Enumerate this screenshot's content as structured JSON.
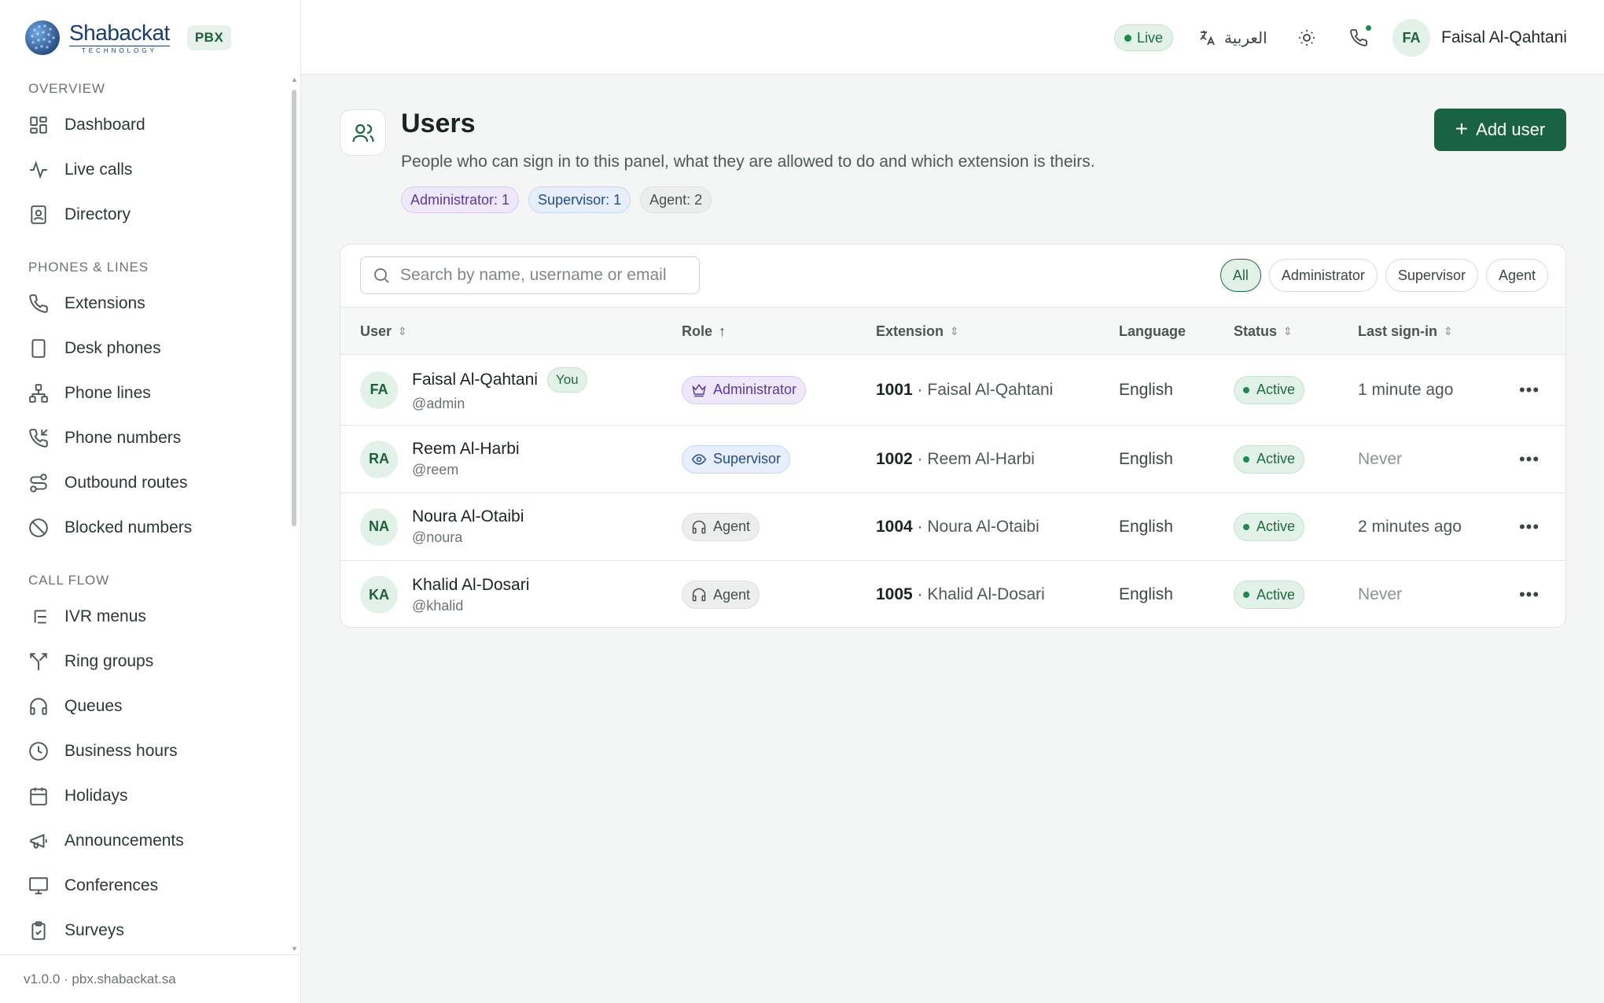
{
  "brand": {
    "name": "Shabackat",
    "sub": "TECHNOLOGY",
    "badge": "PBX"
  },
  "sidebar": {
    "sections": [
      {
        "title": "OVERVIEW",
        "items": [
          {
            "label": "Dashboard",
            "icon": "dashboard-icon"
          },
          {
            "label": "Live calls",
            "icon": "activity-icon"
          },
          {
            "label": "Directory",
            "icon": "contact-book-icon"
          }
        ]
      },
      {
        "title": "PHONES & LINES",
        "items": [
          {
            "label": "Extensions",
            "icon": "phone-icon"
          },
          {
            "label": "Desk phones",
            "icon": "device-icon"
          },
          {
            "label": "Phone lines",
            "icon": "network-icon"
          },
          {
            "label": "Phone numbers",
            "icon": "phone-incoming-icon"
          },
          {
            "label": "Outbound routes",
            "icon": "route-icon"
          },
          {
            "label": "Blocked numbers",
            "icon": "ban-icon"
          }
        ]
      },
      {
        "title": "CALL FLOW",
        "items": [
          {
            "label": "IVR menus",
            "icon": "list-tree-icon"
          },
          {
            "label": "Ring groups",
            "icon": "split-icon"
          },
          {
            "label": "Queues",
            "icon": "headset-icon"
          },
          {
            "label": "Business hours",
            "icon": "clock-icon"
          },
          {
            "label": "Holidays",
            "icon": "calendar-icon"
          },
          {
            "label": "Announcements",
            "icon": "megaphone-icon"
          },
          {
            "label": "Conferences",
            "icon": "presentation-icon"
          },
          {
            "label": "Surveys",
            "icon": "clipboard-icon"
          }
        ]
      }
    ],
    "footer": "v1.0.0 · pbx.shabackat.sa"
  },
  "topbar": {
    "live": "Live",
    "language": "العربية",
    "user_initials": "FA",
    "user_name": "Faisal Al-Qahtani"
  },
  "page": {
    "title": "Users",
    "description": "People who can sign in to this panel, what they are allowed to do and which extension is theirs.",
    "counts": {
      "admin": "Administrator: 1",
      "supervisor": "Supervisor: 1",
      "agent": "Agent: 2"
    },
    "add_button": "Add user"
  },
  "search": {
    "placeholder": "Search by name, username or email",
    "value": ""
  },
  "filters": [
    "All",
    "Administrator",
    "Supervisor",
    "Agent"
  ],
  "active_filter": "All",
  "table": {
    "columns": {
      "user": "User",
      "role": "Role",
      "extension": "Extension",
      "language": "Language",
      "status": "Status",
      "last_signin": "Last sign-in"
    },
    "rows": [
      {
        "initials": "FA",
        "name": "Faisal Al-Qahtani",
        "you": "You",
        "handle": "@admin",
        "role": "Administrator",
        "ext": "1001",
        "ext_name": " · Faisal Al-Qahtani",
        "language": "English",
        "status": "Active",
        "last_signin": "1 minute ago"
      },
      {
        "initials": "RA",
        "name": "Reem Al-Harbi",
        "handle": "@reem",
        "role": "Supervisor",
        "ext": "1002",
        "ext_name": " · Reem Al-Harbi",
        "language": "English",
        "status": "Active",
        "last_signin": "Never"
      },
      {
        "initials": "NA",
        "name": "Noura Al-Otaibi",
        "handle": "@noura",
        "role": "Agent",
        "ext": "1004",
        "ext_name": " · Noura Al-Otaibi",
        "language": "English",
        "status": "Active",
        "last_signin": "2 minutes ago"
      },
      {
        "initials": "KA",
        "name": "Khalid Al-Dosari",
        "handle": "@khalid",
        "role": "Agent",
        "ext": "1005",
        "ext_name": " · Khalid Al-Dosari",
        "language": "English",
        "status": "Active",
        "last_signin": "Never"
      }
    ]
  },
  "colors": {
    "accent": "#1a6340",
    "admin": "#5b3a9a",
    "supervisor": "#254d87"
  }
}
